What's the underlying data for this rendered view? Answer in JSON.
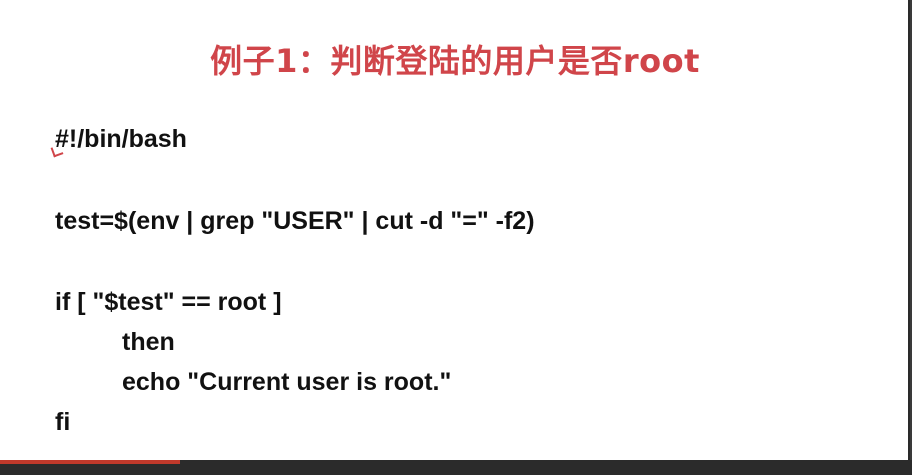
{
  "slide": {
    "title": "例子1：判断登陆的用户是否root",
    "code_lines": [
      "#!/bin/bash",
      "test=$(env | grep \"USER\" | cut -d \"=\" -f2)",
      "if [ \"$test\" == root ]",
      "then",
      "echo \"Current user is root.\"",
      "fi"
    ]
  },
  "colors": {
    "title": "#d0454a",
    "code": "#111111",
    "background": "#ffffff"
  }
}
